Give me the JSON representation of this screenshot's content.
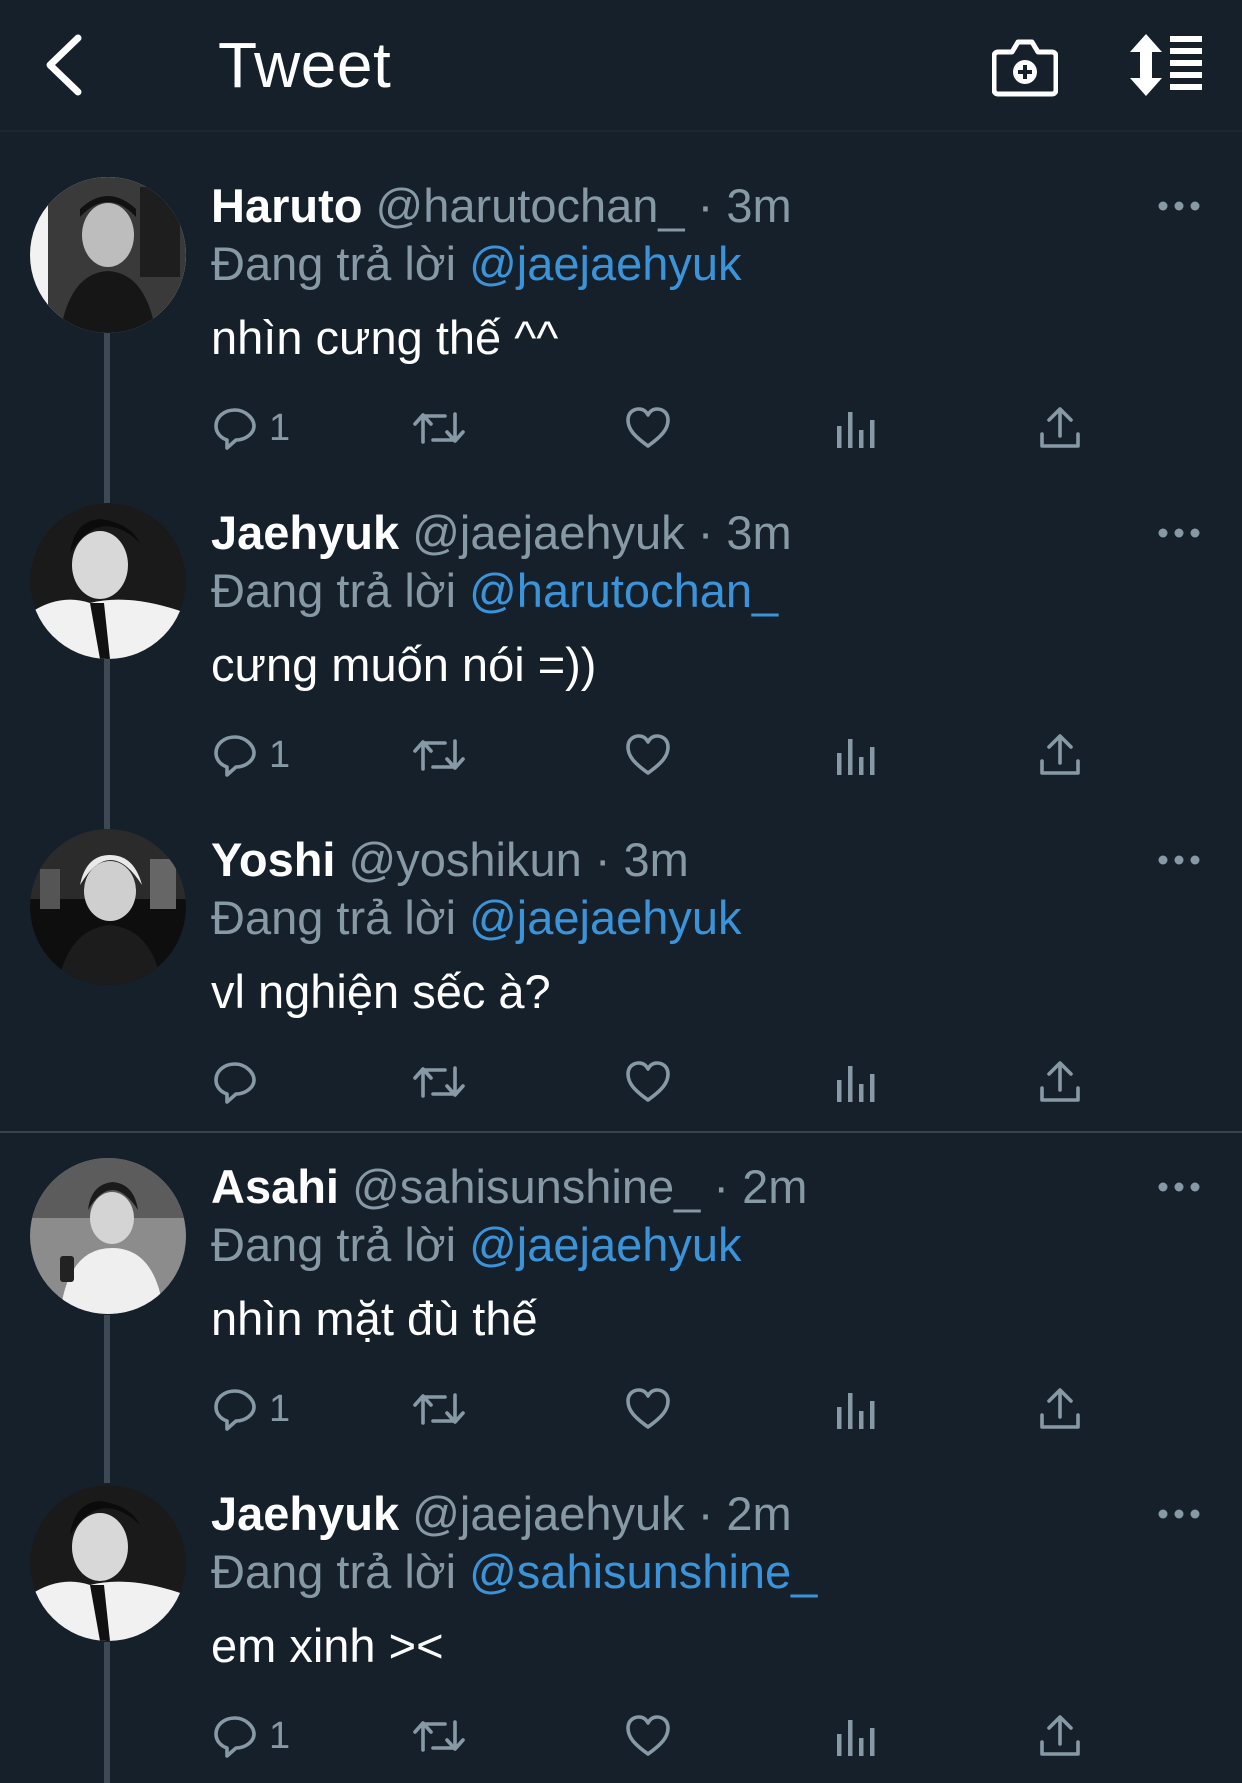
{
  "header": {
    "title": "Tweet",
    "back_icon": "chevron-left-icon",
    "camera_icon": "camera-plus-icon",
    "sort_icon": "sort-list-icon"
  },
  "reply_prefix": "Đang trả lời",
  "colors": {
    "background": "#15202b",
    "secondary_text": "#8899a6",
    "link": "#3b94d9",
    "thread_line": "#3d4954"
  },
  "tweets": [
    {
      "name": "Haruto",
      "handle": "@harutochan_",
      "dot": "·",
      "time": "3m",
      "reply_to": "@jaejaehyuk",
      "text": "nhìn cưng thế ^^",
      "reply_count": "1"
    },
    {
      "name": "Jaehyuk",
      "handle": "@jaejaehyuk",
      "dot": "·",
      "time": "3m",
      "reply_to": "@harutochan_",
      "text": "cưng muốn nói =))",
      "reply_count": "1"
    },
    {
      "name": "Yoshi",
      "handle": "@yoshikun",
      "dot": "·",
      "time": "3m",
      "reply_to": "@jaejaehyuk",
      "text": "vl nghiện sếc à?",
      "reply_count": ""
    },
    {
      "name": "Asahi",
      "handle": "@sahisunshine_",
      "dot": "·",
      "time": "2m",
      "reply_to": "@jaejaehyuk",
      "text": "nhìn mặt đù thế",
      "reply_count": "1"
    },
    {
      "name": "Jaehyuk",
      "handle": "@jaejaehyuk",
      "dot": "·",
      "time": "2m",
      "reply_to": "@sahisunshine_",
      "text": "em xinh ><",
      "reply_count": "1"
    }
  ]
}
